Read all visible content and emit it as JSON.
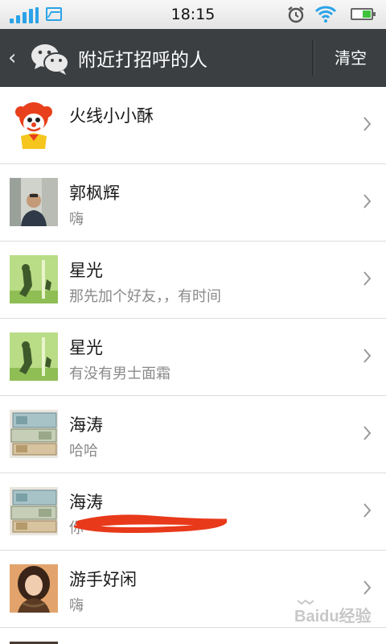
{
  "status_bar": {
    "time": "18:15",
    "battery_level": 0.45,
    "signal_icon": "signal-bars-icon",
    "wifi_icon": "wifi-icon",
    "alarm_icon": "alarm-clock-icon"
  },
  "header": {
    "back_icon": "chevron-left-icon",
    "logo_icon": "wechat-logo-icon",
    "title": "附近打招呼的人",
    "clear_label": "清空"
  },
  "list": [
    {
      "name": "火线小小酥",
      "message": "",
      "avatar": "clown-avatar"
    },
    {
      "name": "郭枫辉",
      "message": "嗨",
      "avatar": "man-photo-avatar"
    },
    {
      "name": "星光",
      "message": "那先加个好友，，有时间",
      "avatar": "green-figure-avatar"
    },
    {
      "name": "星光",
      "message": "有没有男士面霜",
      "avatar": "green-figure-avatar"
    },
    {
      "name": "海涛",
      "message": "哈哈",
      "avatar": "banknotes-avatar"
    },
    {
      "name": "海涛",
      "message": "你",
      "avatar": "banknotes-avatar"
    },
    {
      "name": "游手好闲",
      "message": "嗨",
      "avatar": "woman-photo-avatar"
    }
  ],
  "watermark": {
    "text": "Baidu经验"
  },
  "colors": {
    "titlebar": "#3b3f42",
    "accent_blue": "#2aa3e8",
    "redaction": "#e8391a"
  }
}
